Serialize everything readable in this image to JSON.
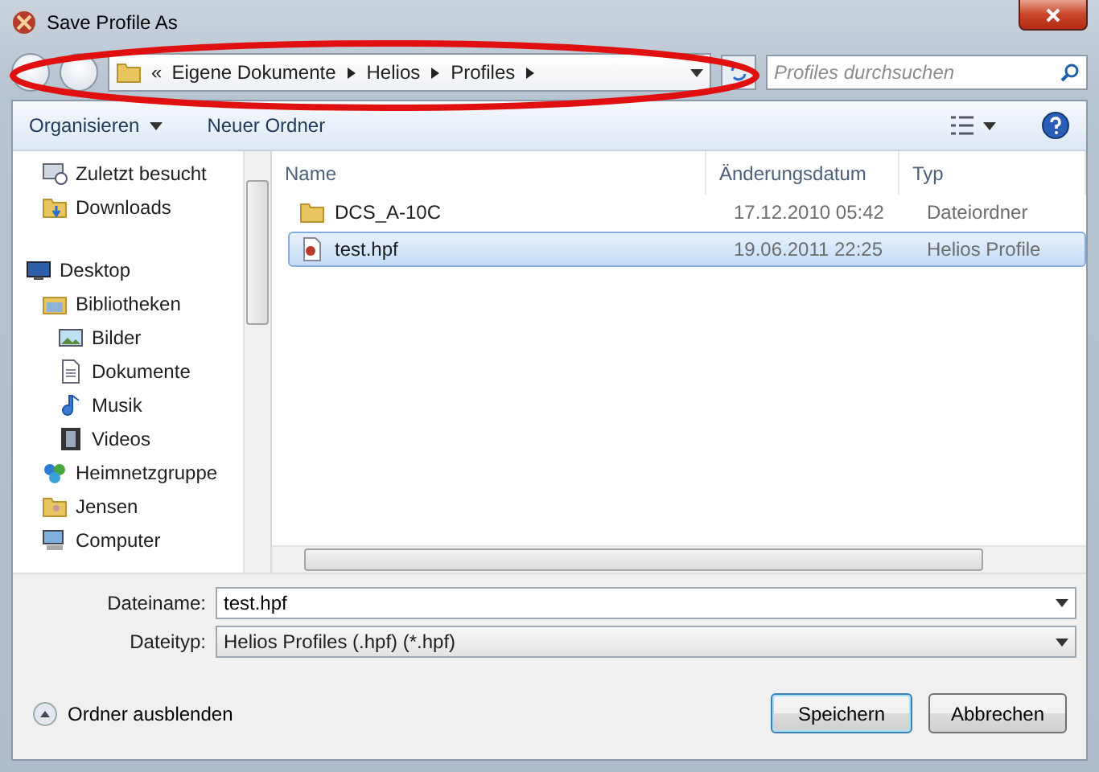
{
  "window": {
    "title": "Save Profile As"
  },
  "address": {
    "overflow": "«",
    "crumbs": [
      "Eigene Dokumente",
      "Helios",
      "Profiles"
    ]
  },
  "search": {
    "placeholder": "Profiles durchsuchen"
  },
  "toolbar": {
    "organize": "Organisieren",
    "new_folder": "Neuer Ordner"
  },
  "favorites": [
    {
      "label": "Zuletzt besucht",
      "kind": "recent"
    },
    {
      "label": "Downloads",
      "kind": "downloads"
    }
  ],
  "tree": [
    {
      "label": "Desktop",
      "kind": "desktop",
      "children": [
        {
          "label": "Bibliotheken",
          "kind": "library",
          "children": [
            {
              "label": "Bilder",
              "kind": "pictures"
            },
            {
              "label": "Dokumente",
              "kind": "documents"
            },
            {
              "label": "Musik",
              "kind": "music"
            },
            {
              "label": "Videos",
              "kind": "videos"
            }
          ]
        },
        {
          "label": "Heimnetzgruppe",
          "kind": "homegroup"
        },
        {
          "label": "Jensen",
          "kind": "user"
        },
        {
          "label": "Computer",
          "kind": "computer"
        }
      ]
    }
  ],
  "table": {
    "columns": [
      "Name",
      "Änderungsdatum",
      "Typ"
    ],
    "rows": [
      {
        "name": "DCS_A-10C",
        "date": "17.12.2010 05:42",
        "type": "Dateiordner",
        "kind": "folder",
        "selected": false
      },
      {
        "name": "test.hpf",
        "date": "19.06.2011 22:25",
        "type": "Helios Profile",
        "kind": "file",
        "selected": true
      }
    ]
  },
  "filename": {
    "label": "Dateiname:",
    "value": "test.hpf"
  },
  "filetype": {
    "label": "Dateityp:",
    "value": "Helios Profiles (.hpf) (*.hpf)"
  },
  "footer": {
    "toggle": "Ordner ausblenden",
    "buttons": [
      {
        "label": "Speichern",
        "kind": "default"
      },
      {
        "label": "Abbrechen",
        "kind": "normal"
      }
    ]
  }
}
